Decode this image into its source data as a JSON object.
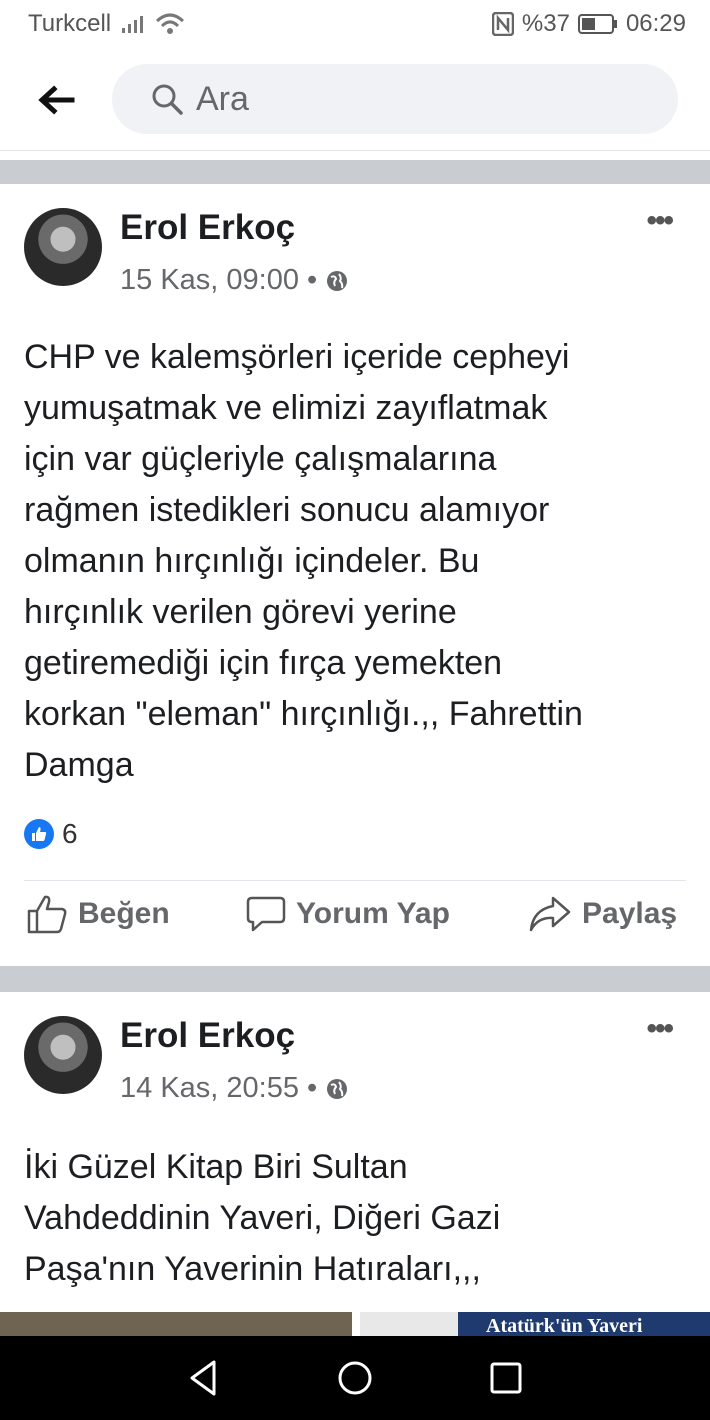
{
  "status_bar": {
    "carrier": "Turkcell",
    "battery": "%37",
    "time": "06:29"
  },
  "search": {
    "placeholder": "Ara"
  },
  "posts": [
    {
      "author": "Erol Erkoç",
      "date": "15 Kas, 09:00",
      "separator": "•",
      "text_lines": [
        "CHP ve kalemşörleri içeride cepheyi",
        "yumuşatmak ve elimizi zayıflatmak",
        "için var güçleriyle çalışmalarına",
        "rağmen istedikleri sonucu alamıyor",
        "olmanın hırçınlığı içindeler. Bu",
        "hırçınlık verilen görevi yerine",
        "getiremediği için fırça yemekten",
        "korkan \"eleman\" hırçınlığı.,, Fahrettin",
        "Damga"
      ],
      "like_count": "6",
      "actions": {
        "like": "Beğen",
        "comment": "Yorum Yap",
        "share": "Paylaş"
      }
    },
    {
      "author": "Erol Erkoç",
      "date": "14 Kas, 20:55",
      "separator": "•",
      "text_lines": [
        "İki Güzel Kitap Biri Sultan",
        "Vahdeddinin Yaveri, Diğeri Gazi",
        "Paşa'nın Yaverinin Hatıraları,,,"
      ],
      "photo_caption": "Atatürk'ün Yaveri"
    }
  ],
  "icons": {
    "back": "arrow-left-icon",
    "search": "search-icon",
    "more": "more-dots-icon",
    "privacy": "globe-icon"
  },
  "colors": {
    "accent": "#1877f2",
    "secondary_text": "#65676b",
    "divider": "#c9ccd1"
  }
}
